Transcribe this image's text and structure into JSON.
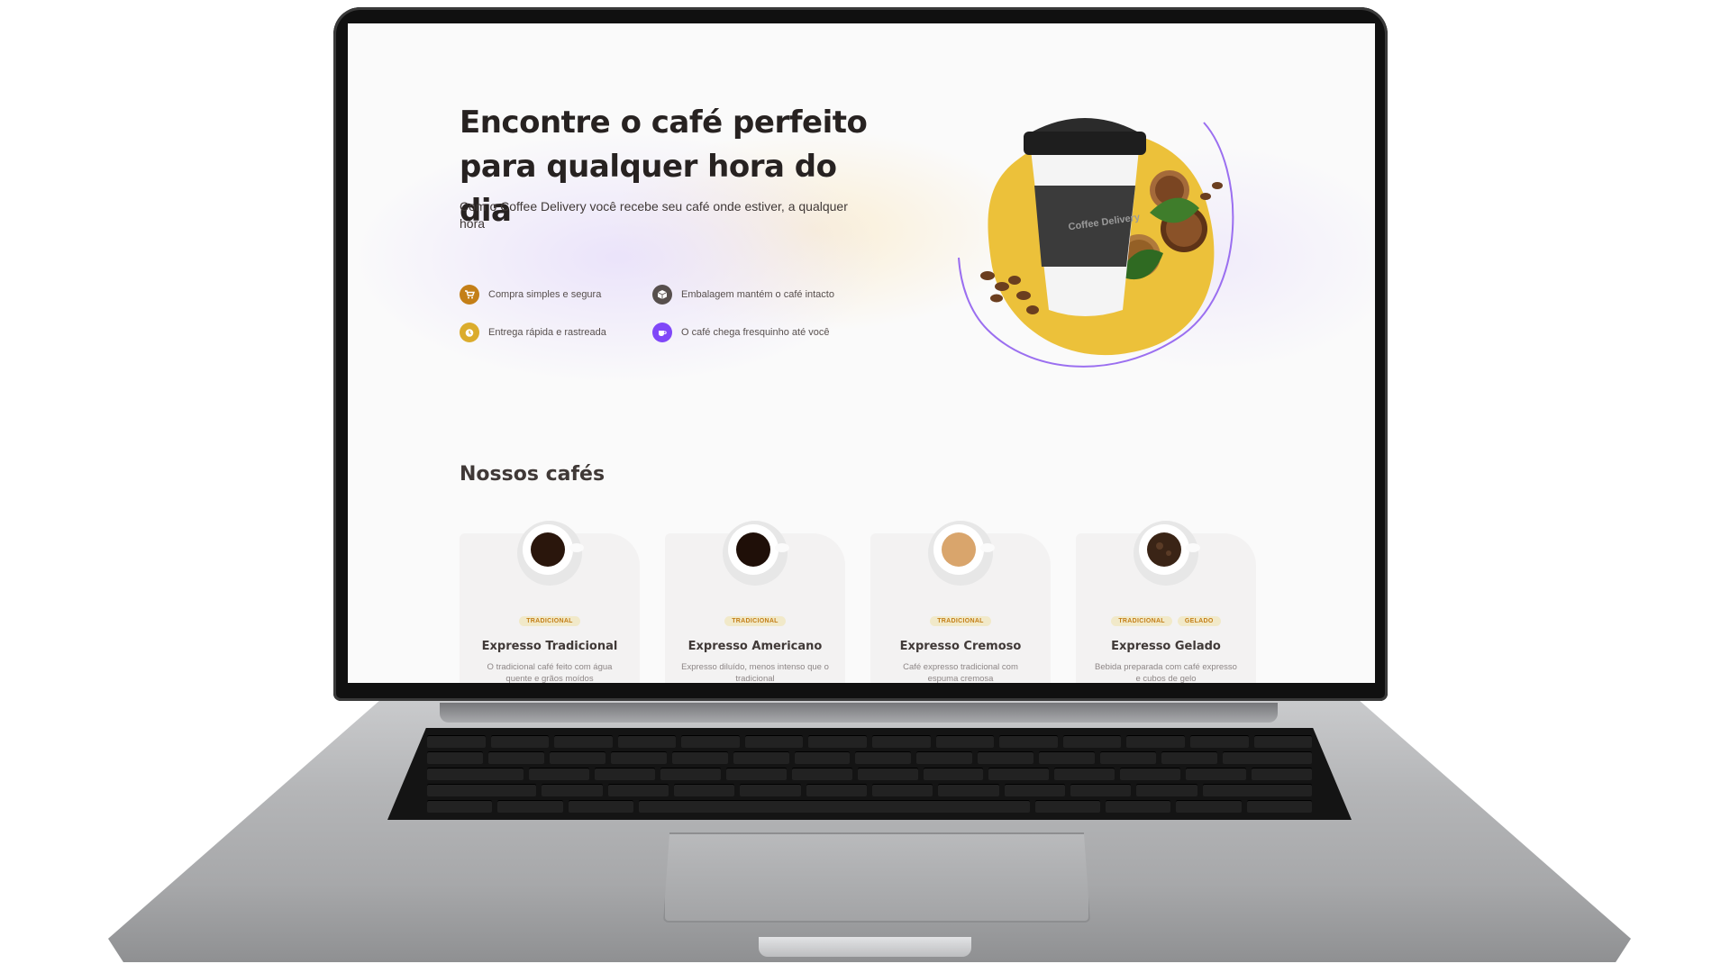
{
  "hero": {
    "title": "Encontre o café perfeito para qualquer hora do dia",
    "subtitle": "Com o Coffee Delivery você recebe seu café onde estiver, a qualquer hora",
    "features": [
      {
        "label": "Compra simples e segura",
        "icon": "cart-icon",
        "color": "#c47f17"
      },
      {
        "label": "Embalagem mantém o café intacto",
        "icon": "package-icon",
        "color": "#574f4d"
      },
      {
        "label": "Entrega rápida e rastreada",
        "icon": "timer-icon",
        "color": "#dbac2c"
      },
      {
        "label": "O café chega fresquinho até você",
        "icon": "coffee-icon",
        "color": "#8047f8"
      }
    ],
    "cup_brand": "Coffee Delivery"
  },
  "catalog": {
    "title": "Nossos cafés",
    "items": [
      {
        "name": "Expresso Tradicional",
        "tags": [
          "TRADICIONAL"
        ],
        "description": "O tradicional café feito com água quente e grãos moídos",
        "liquid": "#2a160c"
      },
      {
        "name": "Expresso Americano",
        "tags": [
          "TRADICIONAL"
        ],
        "description": "Expresso diluído, menos intenso que o tradicional",
        "liquid": "#1f0f08"
      },
      {
        "name": "Expresso Cremoso",
        "tags": [
          "TRADICIONAL"
        ],
        "description": "Café expresso tradicional com espuma cremosa",
        "liquid": "#d9a56c"
      },
      {
        "name": "Expresso Gelado",
        "tags": [
          "TRADICIONAL",
          "GELADO"
        ],
        "description": "Bebida preparada com café expresso e cubos de gelo",
        "liquid": "#3a2416"
      }
    ]
  },
  "colors": {
    "yellow": "#dbac2c",
    "yellow_dark": "#c47f17",
    "purple": "#8047f8",
    "text_title": "#272221"
  }
}
